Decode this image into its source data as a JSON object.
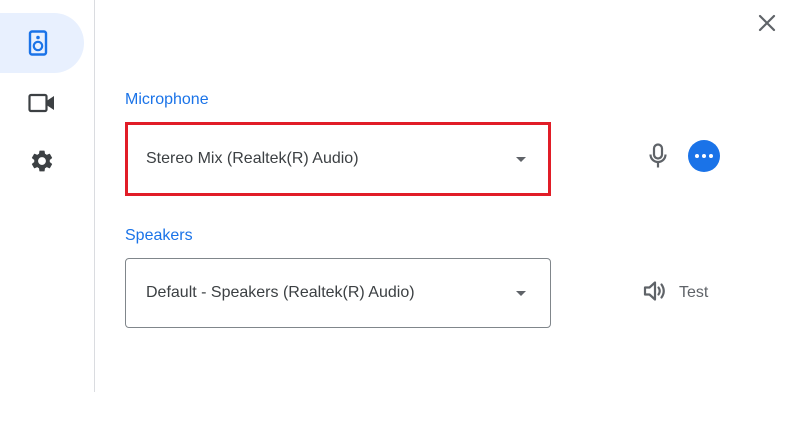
{
  "sidebar": {
    "items": [
      {
        "icon": "speaker-icon",
        "active": true
      },
      {
        "icon": "video-camera-icon",
        "active": false
      },
      {
        "icon": "gear-icon",
        "active": false
      }
    ]
  },
  "close": {
    "icon": "close-icon"
  },
  "microphone": {
    "label": "Microphone",
    "selected": "Stereo Mix (Realtek(R) Audio)"
  },
  "speakers": {
    "label": "Speakers",
    "selected": "Default - Speakers (Realtek(R) Audio)",
    "test_label": "Test"
  },
  "colors": {
    "accent": "#1a73e8",
    "highlight_border": "#e11d27",
    "active_nav_bg": "#e8f0fe",
    "text": "#3c4043",
    "icon": "#5f6368"
  }
}
